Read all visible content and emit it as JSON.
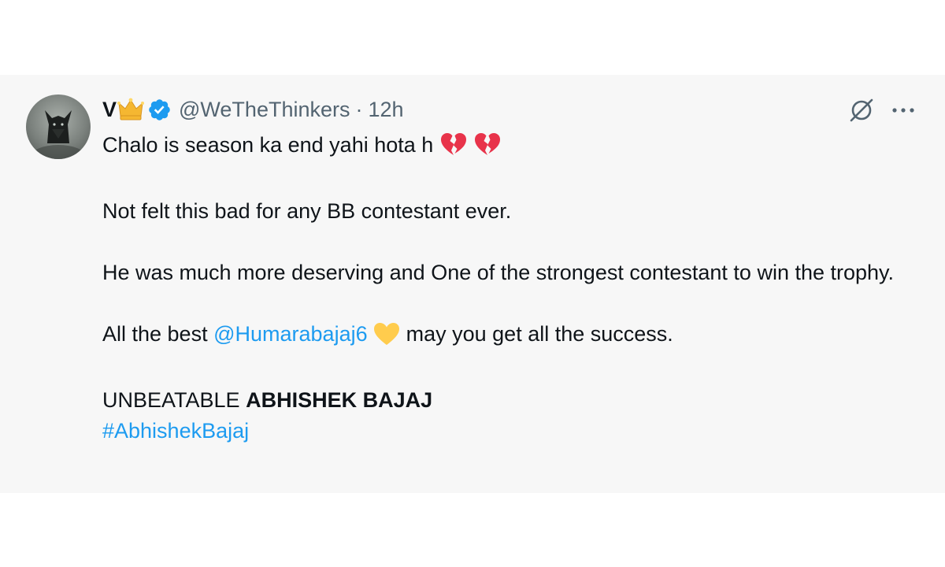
{
  "tweet": {
    "display_name": "V",
    "handle": "@WeTheThinkers",
    "separator": "·",
    "time": "12h",
    "icons": {
      "avatar": "wolf-avatar",
      "crown": "crown-icon",
      "verified": "verified-badge-icon",
      "grok": "grok-icon",
      "more": "more-icon",
      "broken_heart": "broken-heart-emoji",
      "yellow_heart": "yellow-heart-emoji"
    },
    "colors": {
      "link": "#1d9bf0",
      "verified": "#1d9bf0",
      "broken_heart": "#e8334a",
      "yellow_heart": "#ffcc4d",
      "crown": "#f5b731"
    },
    "lines": {
      "line1": "Chalo is season ka end yahi hota h",
      "line2": "Not felt this bad for any BB contestant ever.",
      "line3": "He was much more deserving and One of the strongest contestant to win the trophy.",
      "line4_prefix": "All the best",
      "mention": "@Humarabajaj6",
      "line4_suffix": "may you get all the success.",
      "line5_prefix": "UNBEATABLE",
      "line5_bold": "ABHISHEK BAJAJ",
      "hashtag": "#AbhishekBajaj"
    }
  }
}
